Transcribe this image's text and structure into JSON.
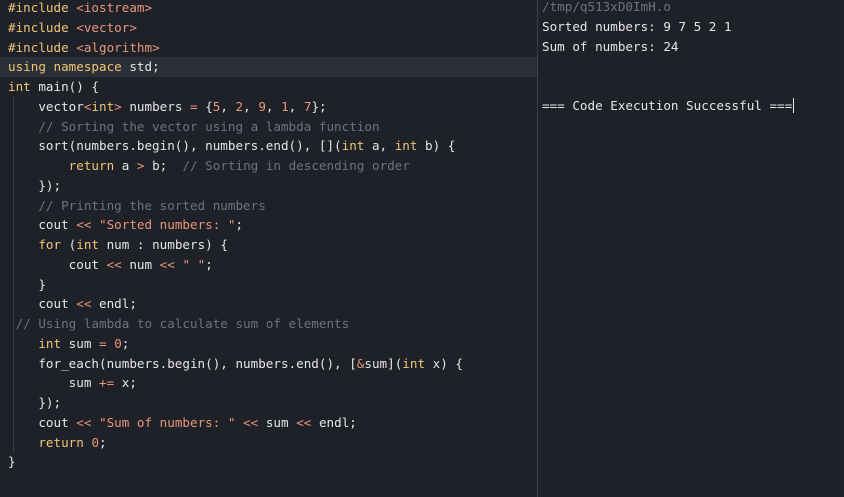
{
  "editor": {
    "lines": [
      [
        {
          "t": "#include ",
          "c": "kw"
        },
        {
          "t": "<iostream>",
          "c": "str"
        }
      ],
      [
        {
          "t": "#include ",
          "c": "kw"
        },
        {
          "t": "<vector>",
          "c": "str"
        }
      ],
      [
        {
          "t": "#include ",
          "c": "kw"
        },
        {
          "t": "<algorithm>",
          "c": "str"
        }
      ],
      [
        {
          "t": "using namespace ",
          "c": "kw"
        },
        {
          "t": "std;",
          "c": "id"
        }
      ],
      [
        {
          "t": "int ",
          "c": "kw"
        },
        {
          "t": "main() {",
          "c": "id"
        }
      ],
      [
        {
          "t": "    vector",
          "c": "id"
        },
        {
          "t": "<",
          "c": "op"
        },
        {
          "t": "int",
          "c": "kw"
        },
        {
          "t": ">",
          "c": "op"
        },
        {
          "t": " numbers ",
          "c": "id"
        },
        {
          "t": "=",
          "c": "op"
        },
        {
          "t": " {",
          "c": "id"
        },
        {
          "t": "5",
          "c": "num"
        },
        {
          "t": ", ",
          "c": "id"
        },
        {
          "t": "2",
          "c": "num"
        },
        {
          "t": ", ",
          "c": "id"
        },
        {
          "t": "9",
          "c": "num"
        },
        {
          "t": ", ",
          "c": "id"
        },
        {
          "t": "1",
          "c": "num"
        },
        {
          "t": ", ",
          "c": "id"
        },
        {
          "t": "7",
          "c": "num"
        },
        {
          "t": "};",
          "c": "id"
        }
      ],
      [
        {
          "t": "    // Sorting the vector using a lambda function",
          "c": "cm"
        }
      ],
      [
        {
          "t": "    sort(numbers.begin(), numbers.end(), [](",
          "c": "id"
        },
        {
          "t": "int",
          "c": "kw"
        },
        {
          "t": " a, ",
          "c": "id"
        },
        {
          "t": "int",
          "c": "kw"
        },
        {
          "t": " b) {",
          "c": "id"
        }
      ],
      [
        {
          "t": "        ",
          "c": "id"
        },
        {
          "t": "return",
          "c": "kw"
        },
        {
          "t": " a ",
          "c": "id"
        },
        {
          "t": ">",
          "c": "op"
        },
        {
          "t": " b;  ",
          "c": "id"
        },
        {
          "t": "// Sorting in descending order",
          "c": "cm"
        }
      ],
      [
        {
          "t": "    });",
          "c": "id"
        }
      ],
      [
        {
          "t": "    // Printing the sorted numbers",
          "c": "cm"
        }
      ],
      [
        {
          "t": "    cout ",
          "c": "id"
        },
        {
          "t": "<<",
          "c": "op"
        },
        {
          "t": " ",
          "c": "id"
        },
        {
          "t": "\"Sorted numbers: \"",
          "c": "str"
        },
        {
          "t": ";",
          "c": "id"
        }
      ],
      [
        {
          "t": "    ",
          "c": "id"
        },
        {
          "t": "for",
          "c": "kw"
        },
        {
          "t": " (",
          "c": "id"
        },
        {
          "t": "int",
          "c": "kw"
        },
        {
          "t": " num : numbers) {",
          "c": "id"
        }
      ],
      [
        {
          "t": "        cout ",
          "c": "id"
        },
        {
          "t": "<<",
          "c": "op"
        },
        {
          "t": " num ",
          "c": "id"
        },
        {
          "t": "<<",
          "c": "op"
        },
        {
          "t": " ",
          "c": "id"
        },
        {
          "t": "\" \"",
          "c": "str"
        },
        {
          "t": ";",
          "c": "id"
        }
      ],
      [
        {
          "t": "    }",
          "c": "id"
        }
      ],
      [
        {
          "t": "    cout ",
          "c": "id"
        },
        {
          "t": "<<",
          "c": "op"
        },
        {
          "t": " endl;",
          "c": "id"
        }
      ],
      [
        {
          "t": " // Using lambda to calculate sum of elements",
          "c": "cm"
        }
      ],
      [
        {
          "t": "    ",
          "c": "id"
        },
        {
          "t": "int",
          "c": "kw"
        },
        {
          "t": " sum ",
          "c": "id"
        },
        {
          "t": "=",
          "c": "op"
        },
        {
          "t": " ",
          "c": "id"
        },
        {
          "t": "0",
          "c": "num"
        },
        {
          "t": ";",
          "c": "id"
        }
      ],
      [
        {
          "t": "    for_each(numbers.begin(), numbers.end(), [",
          "c": "id"
        },
        {
          "t": "&",
          "c": "op"
        },
        {
          "t": "sum](",
          "c": "id"
        },
        {
          "t": "int",
          "c": "kw"
        },
        {
          "t": " x) {",
          "c": "id"
        }
      ],
      [
        {
          "t": "        sum ",
          "c": "id"
        },
        {
          "t": "+=",
          "c": "op"
        },
        {
          "t": " x;",
          "c": "id"
        }
      ],
      [
        {
          "t": "    });",
          "c": "id"
        }
      ],
      [
        {
          "t": "    cout ",
          "c": "id"
        },
        {
          "t": "<<",
          "c": "op"
        },
        {
          "t": " ",
          "c": "id"
        },
        {
          "t": "\"Sum of numbers: \"",
          "c": "str"
        },
        {
          "t": " ",
          "c": "id"
        },
        {
          "t": "<<",
          "c": "op"
        },
        {
          "t": " sum ",
          "c": "id"
        },
        {
          "t": "<<",
          "c": "op"
        },
        {
          "t": " endl;",
          "c": "id"
        }
      ],
      [
        {
          "t": "    ",
          "c": "id"
        },
        {
          "t": "return",
          "c": "kw"
        },
        {
          "t": " ",
          "c": "id"
        },
        {
          "t": "0",
          "c": "num"
        },
        {
          "t": ";",
          "c": "id"
        }
      ],
      [
        {
          "t": "}",
          "c": "id"
        }
      ]
    ],
    "active_line": 3
  },
  "output": {
    "path": "/tmp/q513xD0ImH.o",
    "line1": "Sorted numbers: 9 7 5 2 1",
    "line2": "Sum of numbers: 24",
    "status": "=== Code Execution Successful ==="
  },
  "colors": {
    "background": "#1e2128",
    "keyword": "#f0c674",
    "string": "#e9967a",
    "comment": "#6c7380",
    "text": "#e6e6e6"
  }
}
